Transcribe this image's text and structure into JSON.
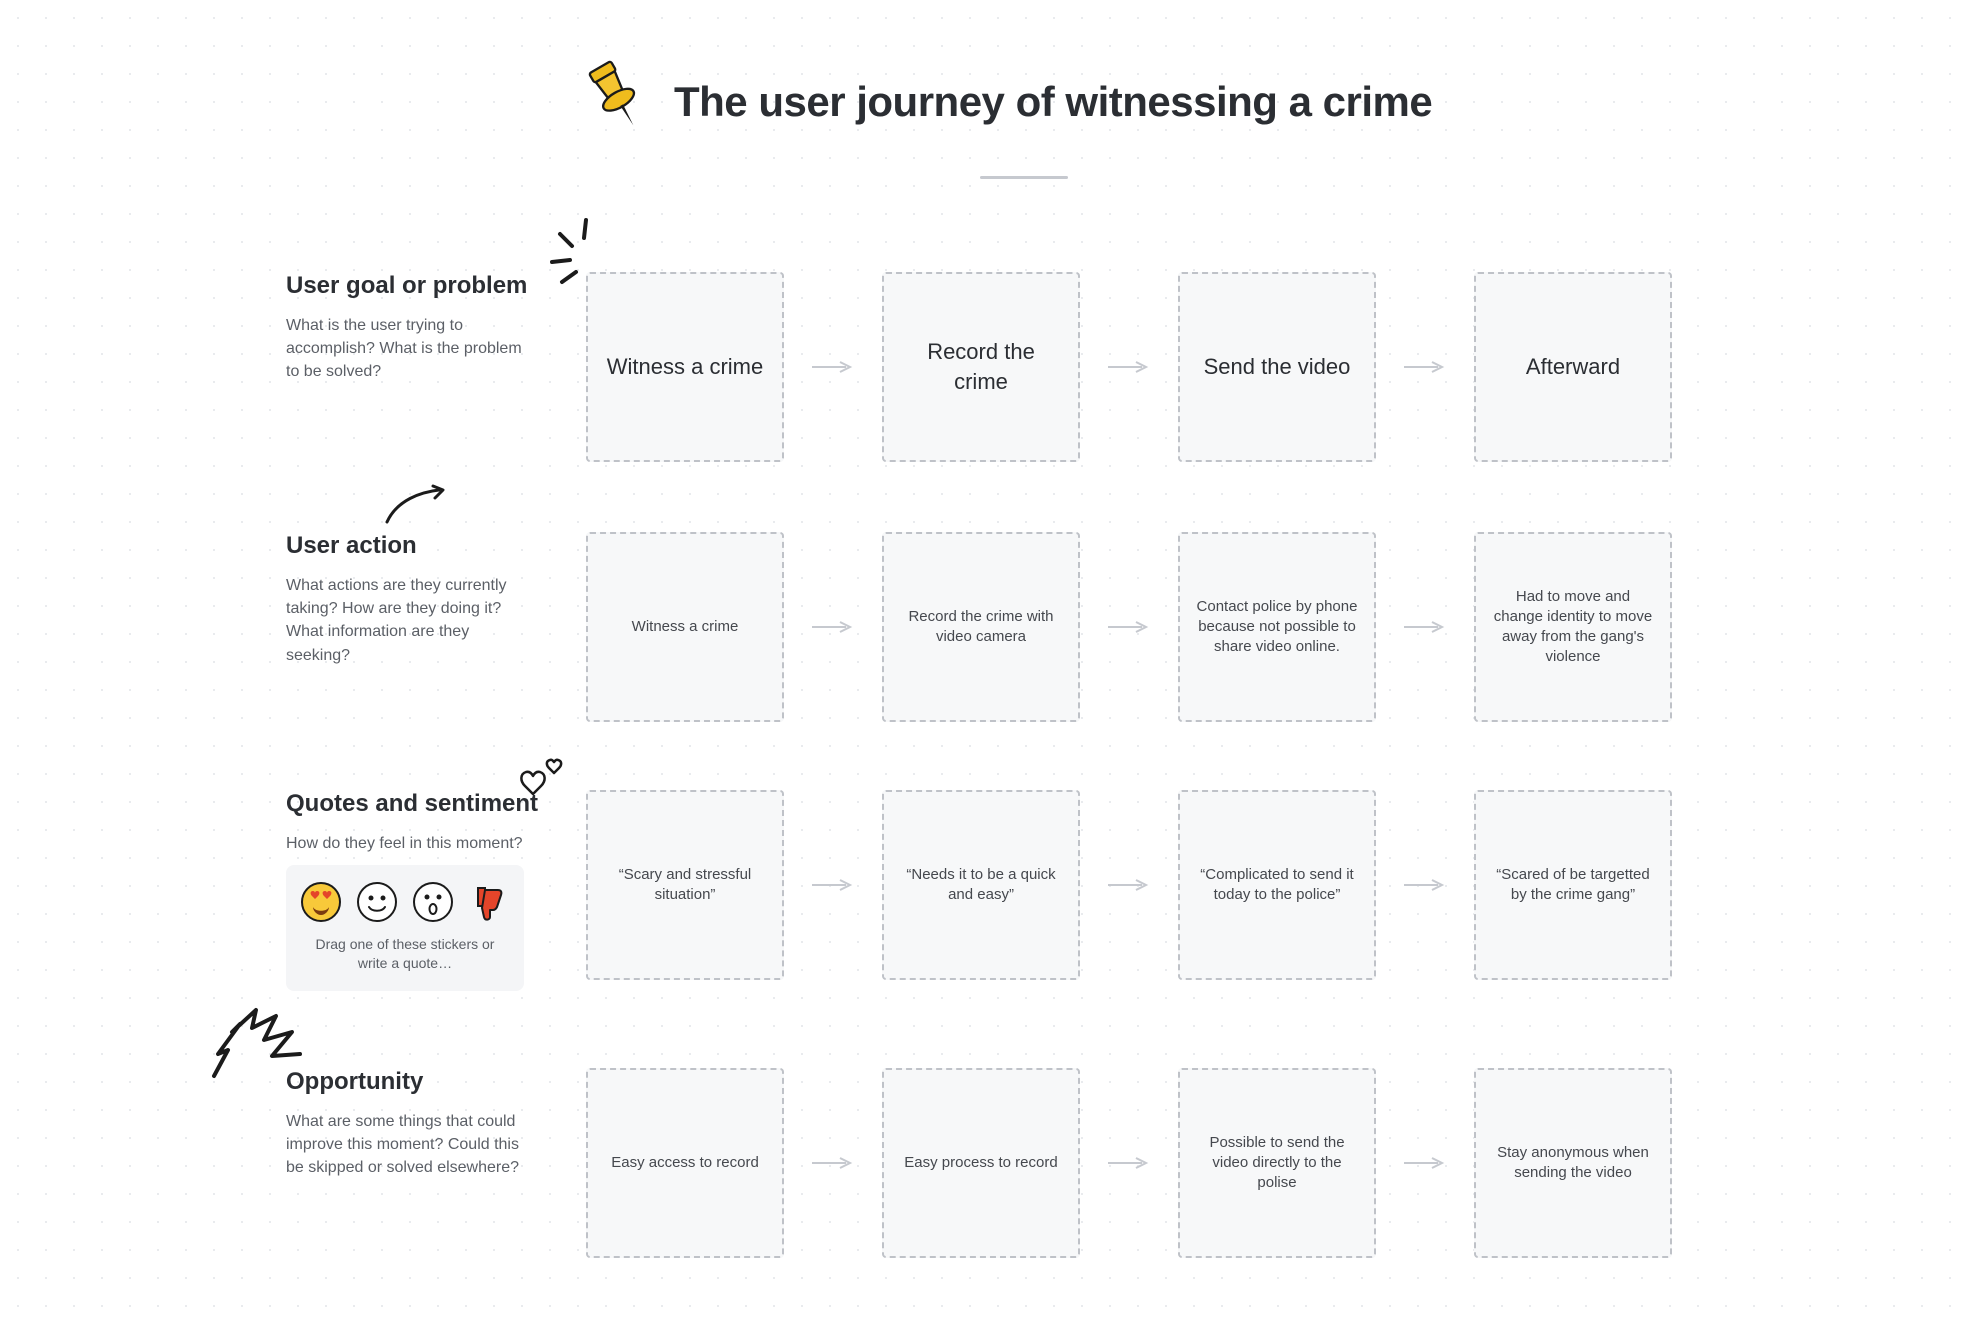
{
  "title": "The user journey of witnessing a crime",
  "rows": {
    "goal": {
      "heading": "User goal or problem",
      "desc": "What is the user trying to accomplish? What is the problem to be solved?",
      "steps": [
        "Witness a crime",
        "Record the crime",
        "Send the video",
        "Afterward"
      ]
    },
    "action": {
      "heading": "User action",
      "desc": "What actions are they currently taking? How are they doing it? What information are they seeking?",
      "steps": [
        "Witness a crime",
        "Record the crime with video camera",
        "Contact police by phone because not possible to share video online.",
        "Had to move and change identity to move away from the gang's violence"
      ]
    },
    "quote": {
      "heading": "Quotes and sentiment",
      "desc": "How do they feel in this moment?",
      "steps": [
        "“Scary and stressful situation”",
        "“Needs it to be a quick and easy”",
        "“Complicated to send it today to the police”",
        "“Scared of be targetted by the crime gang”"
      ],
      "tray_hint": "Drag one of these stickers or write a quote…"
    },
    "opp": {
      "heading": "Opportunity",
      "desc": "What are some things that could improve this moment? Could this be skipped or solved elsewhere?",
      "steps": [
        "Easy access to record",
        "Easy process to record",
        "Possible to send the video directly to the polise",
        "Stay anonymous  when sending the video"
      ]
    }
  },
  "icons": {
    "pin": "pushpin-icon",
    "burst": "burst-lines-icon",
    "arrow": "curved-arrow-icon",
    "hearts": "hearts-icon",
    "zigzag": "zigzag-icon"
  },
  "stickers": [
    "heart-eyes-emoji",
    "smile-emoji",
    "surprised-emoji",
    "thumbs-down-icon"
  ]
}
